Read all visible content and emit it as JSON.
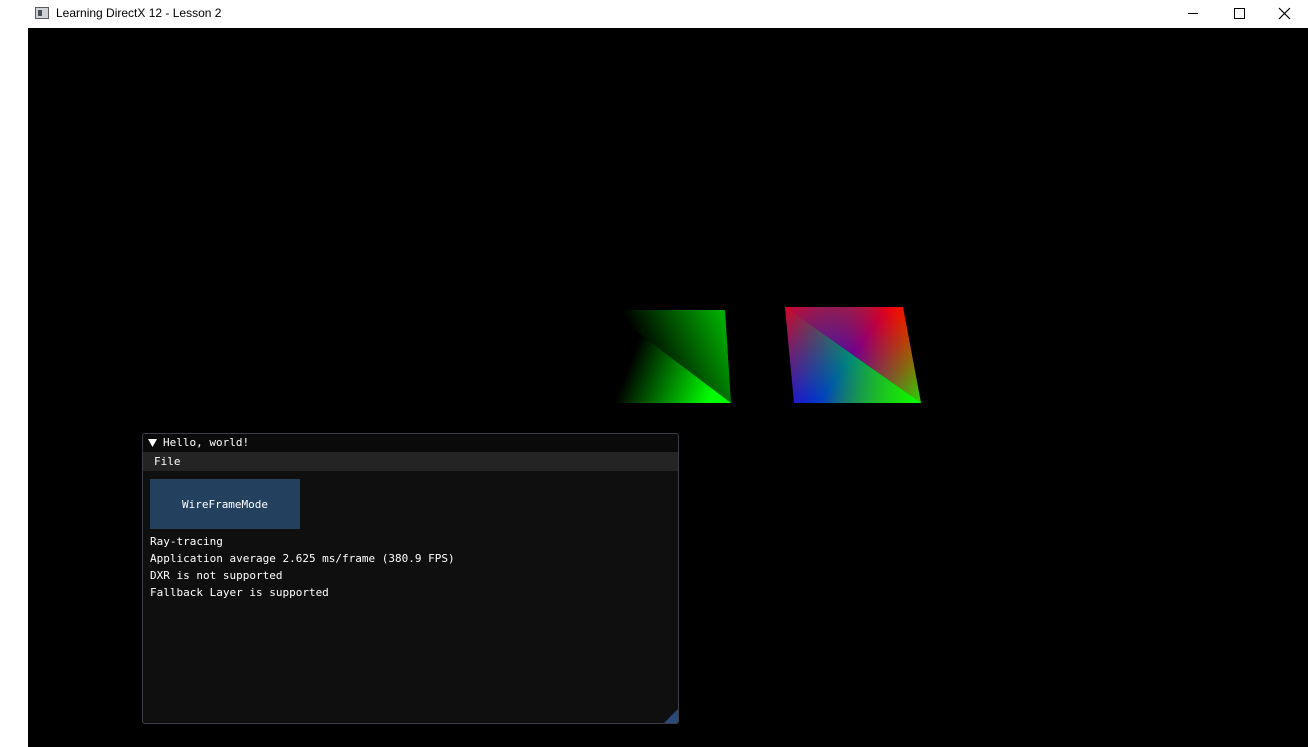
{
  "window": {
    "title": "Learning DirectX 12 - Lesson 2",
    "icon": "app-window-icon",
    "controls": [
      "minimize-icon",
      "maximize-icon",
      "close-icon"
    ]
  },
  "scene": {
    "background": "#000000",
    "quads": [
      {
        "name": "green-gradient-quad",
        "colors": [
          "#000000",
          "#00ff00"
        ]
      },
      {
        "name": "rgb-gradient-quad",
        "colors": [
          "#ff0000",
          "#0000ff",
          "#00ff00"
        ]
      }
    ]
  },
  "imgui": {
    "title": "Hello, world!",
    "menu": {
      "file": "File"
    },
    "wireframe_button": "WireFrameMode",
    "lines": {
      "raytracing": "Ray-tracing",
      "fps": "Application average 2.625 ms/frame (380.9 FPS)",
      "dxr": "DXR is not supported",
      "fallback": "Fallback Layer is supported"
    },
    "colors": {
      "button": "#23405f",
      "background": "#0f0f0f",
      "menubar": "#242424"
    }
  }
}
